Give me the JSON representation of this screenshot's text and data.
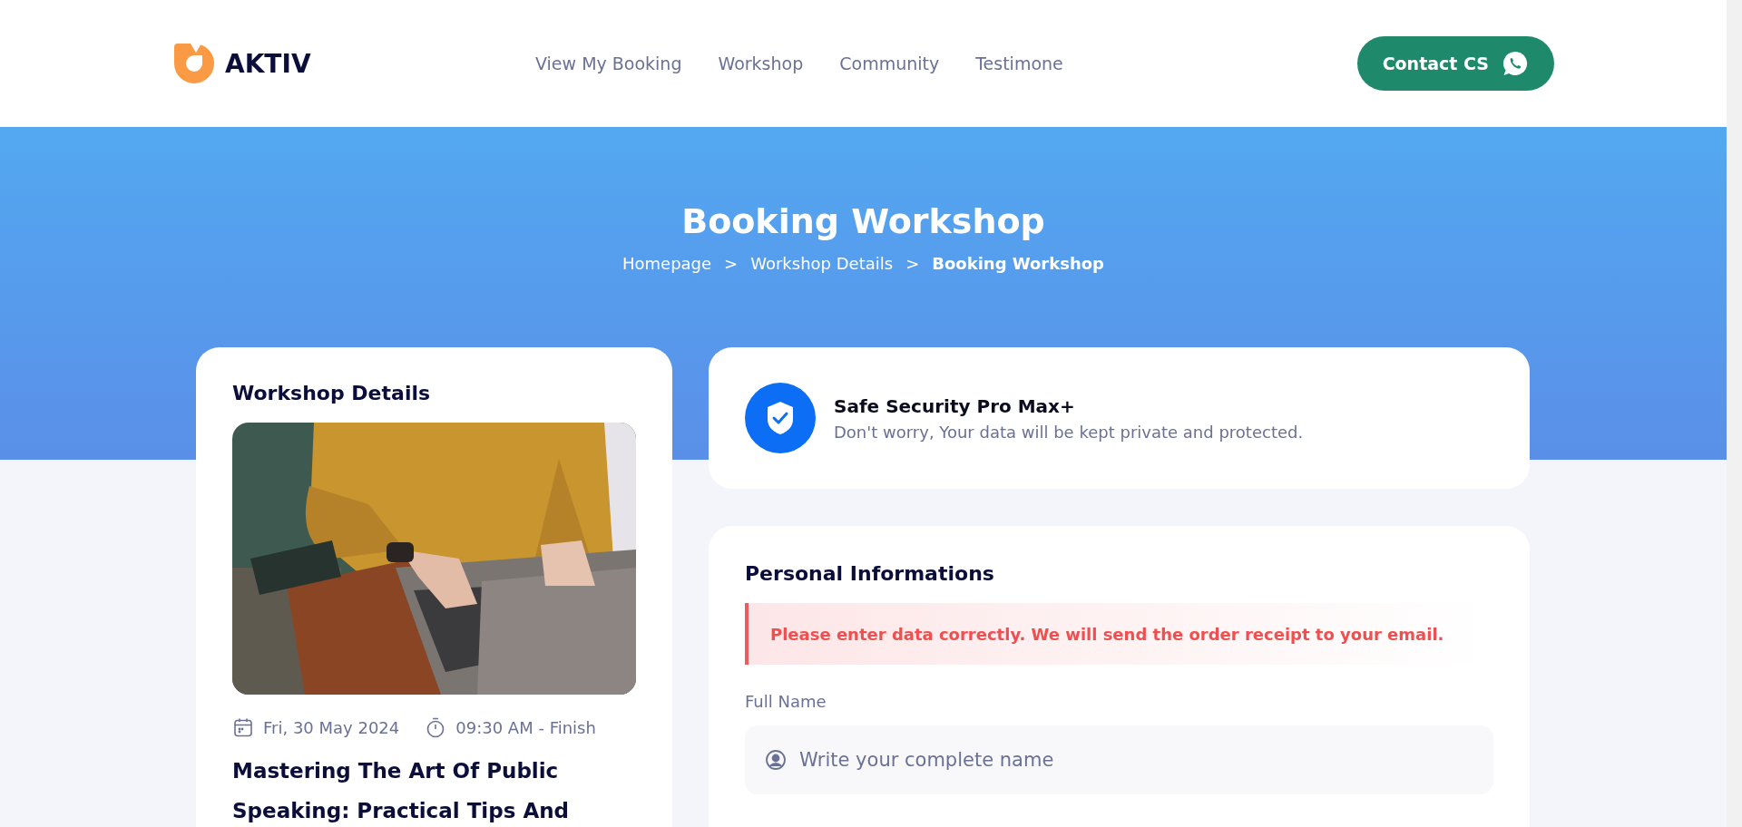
{
  "header": {
    "logo": "AKTIV",
    "nav": [
      {
        "label": "View My Booking"
      },
      {
        "label": "Workshop"
      },
      {
        "label": "Community"
      },
      {
        "label": "Testimone"
      }
    ],
    "contact_button": "Contact CS"
  },
  "hero": {
    "title": "Booking Workshop",
    "breadcrumb": [
      {
        "label": "Homepage",
        "kind": "link",
        "current": false
      },
      {
        "label": ">",
        "kind": "separator"
      },
      {
        "label": "Workshop Details",
        "kind": "link",
        "current": false
      },
      {
        "label": ">",
        "kind": "separator"
      },
      {
        "label": "Booking Workshop",
        "kind": "link",
        "current": true
      }
    ]
  },
  "workshop_card": {
    "title": "Workshop Details",
    "date": "Fri, 30 May 2024",
    "time": "09:30 AM - Finish",
    "name": "Mastering The Art Of Public Speaking: Practical Tips And"
  },
  "security_card": {
    "title": "Safe Security Pro Max+",
    "subtitle": "Don't worry, Your data will be kept private and protected."
  },
  "personal_card": {
    "title": "Personal Informations",
    "alert": "Please enter data correctly. We will send the order receipt to your email.",
    "fields": [
      {
        "label": "Full Name",
        "placeholder": "Write your complete name"
      }
    ]
  }
}
